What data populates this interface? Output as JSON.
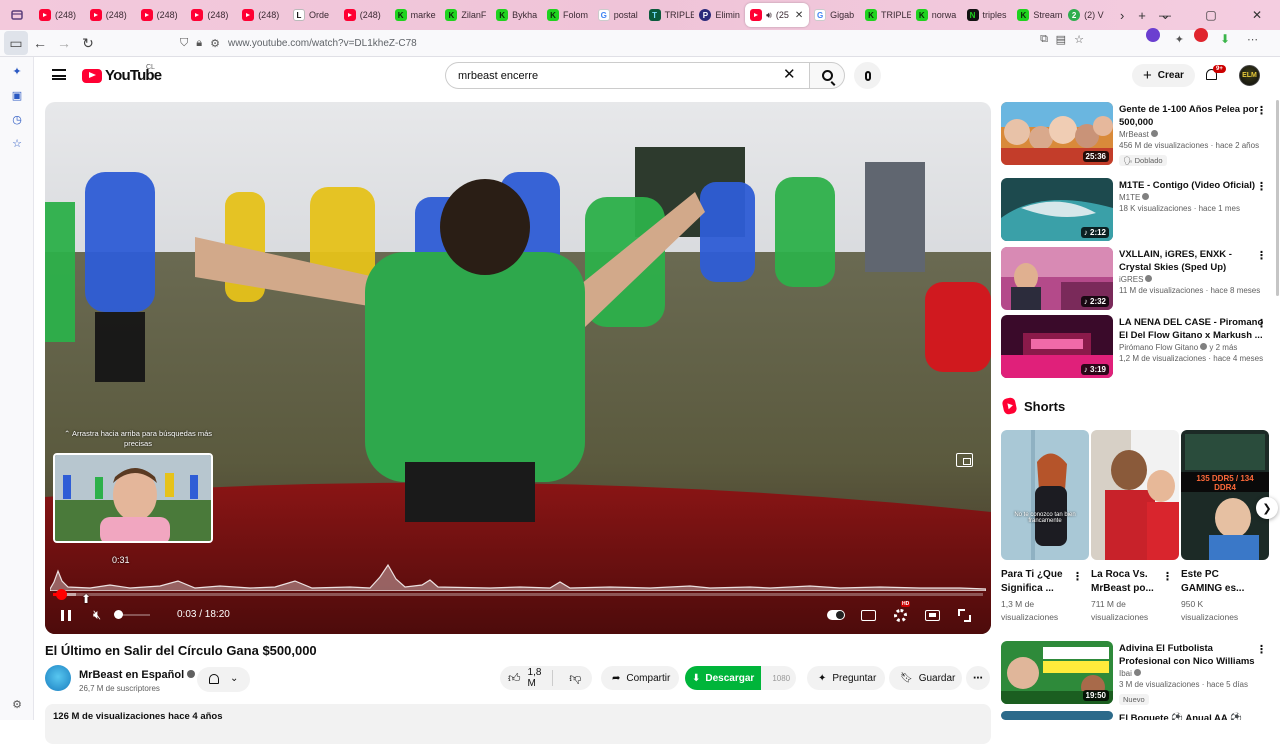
{
  "browser": {
    "tabs": [
      {
        "label": "(248)",
        "icon": "youtube"
      },
      {
        "label": "(248)",
        "icon": "youtube"
      },
      {
        "label": "(248)",
        "icon": "youtube"
      },
      {
        "label": "(248)",
        "icon": "youtube"
      },
      {
        "label": "(248)",
        "icon": "youtube"
      },
      {
        "label": "Orde",
        "icon": "L"
      },
      {
        "label": "(248)",
        "icon": "youtube"
      },
      {
        "label": "marke",
        "icon": "K"
      },
      {
        "label": "ZilanF",
        "icon": "K"
      },
      {
        "label": "Bykha",
        "icon": "K"
      },
      {
        "label": "Folom",
        "icon": "K"
      },
      {
        "label": "postal",
        "icon": "G"
      },
      {
        "label": "TRIPLE",
        "icon": "T"
      },
      {
        "label": "Elimin",
        "icon": "P"
      },
      {
        "label": "(25",
        "icon": "youtube",
        "active": true
      },
      {
        "label": "Gigab",
        "icon": "G"
      },
      {
        "label": "TRIPLE",
        "icon": "K"
      },
      {
        "label": "norwa",
        "icon": "K"
      },
      {
        "label": "triples",
        "icon": "N"
      },
      {
        "label": "Stream",
        "icon": "K"
      },
      {
        "label": "(2) V",
        "icon": "2"
      }
    ],
    "url": "www.youtube.com/watch?v=DL1kheZ-C78"
  },
  "youtube": {
    "logo": "YouTube",
    "country": "CL",
    "search_query": "mrbeast encerre",
    "create_label": "Crear",
    "notif_badge": "9+",
    "avatar_text": "ELM"
  },
  "player": {
    "preview_hint": "⌃ Arrastra hacia arriba para búsquedas más precisas",
    "preview_time": "0:31",
    "time_display": "0:03 / 18:20",
    "progress_played": 0.003,
    "progress_buffered": 0.025,
    "volume": 0.0
  },
  "video": {
    "title": "El Último en Salir del Círculo Gana $500,000",
    "channel": "MrBeast en Español",
    "subscribers": "26,7 M de suscriptores",
    "likes": "1,8 M",
    "share": "Compartir",
    "download": "Descargar",
    "download_quality": "1080",
    "ask": "Preguntar",
    "save": "Guardar",
    "description_line": "126 M de visualizaciones  hace 4 años"
  },
  "recommendations": [
    {
      "title": "Gente de 1-100 Años Pelea por 500,000",
      "channel": "MrBeast",
      "verified": true,
      "stats": "456 M de visualizaciones · hace 2 años",
      "badge": "Doblado",
      "duration": "25:36"
    },
    {
      "title": "M1TE - Contigo (Video Oficial)",
      "channel": "M1TE",
      "verified": true,
      "stats": "18 K visualizaciones · hace 1 mes",
      "badge": "",
      "duration": "♪ 2:12"
    },
    {
      "title": "VXLLAIN, iGRES, ENXK - Crystal Skies (Sped Up)",
      "channel": "iGRES",
      "verified": true,
      "stats": "11 M de visualizaciones · hace 8 meses",
      "badge": "",
      "duration": "♪ 2:32"
    },
    {
      "title": "LA NENA DEL CASE - Piromano El Del Flow Gitano x Markush ...",
      "channel": "Pirómano Flow Gitano",
      "verified": true,
      "channel_suffix": "y 2 más",
      "stats": "1,2 M de visualizaciones · hace 4 meses",
      "badge": "",
      "duration": "♪ 3:19"
    }
  ],
  "shorts": {
    "heading": "Shorts",
    "items": [
      {
        "title": "Para Ti ¿Que Significa ...",
        "views_1": "1,3 M de",
        "views_2": "visualizaciones",
        "caption": "No te conozco tan bien francamente"
      },
      {
        "title": "La Roca Vs. MrBeast po...",
        "views_1": "711 M de",
        "views_2": "visualizaciones",
        "caption": ""
      },
      {
        "title": "Este PC GAMING es...",
        "views_1": "950 K",
        "views_2": "visualizaciones",
        "caption": "135 DDR5 / 134 DDR4"
      }
    ]
  },
  "more_rec": [
    {
      "title": "Adivina El Futbolista Profesional con Nico Williams ...",
      "channel": "Ibai",
      "verified": true,
      "stats": "3 M de visualizaciones · hace 5 días",
      "badge": "Nuevo",
      "duration": "19:50",
      "thumb_text": "ADIVINA EL FUTBOLISTA"
    },
    {
      "title": "El Boquete ⚽ Anual AA ⚽",
      "channel": "",
      "stats": "",
      "badge": "",
      "duration": ""
    }
  ],
  "colors": {
    "yt_red": "#ff0033",
    "download_green": "#00b53a",
    "tabbar_pink": "#f3c9dc"
  }
}
